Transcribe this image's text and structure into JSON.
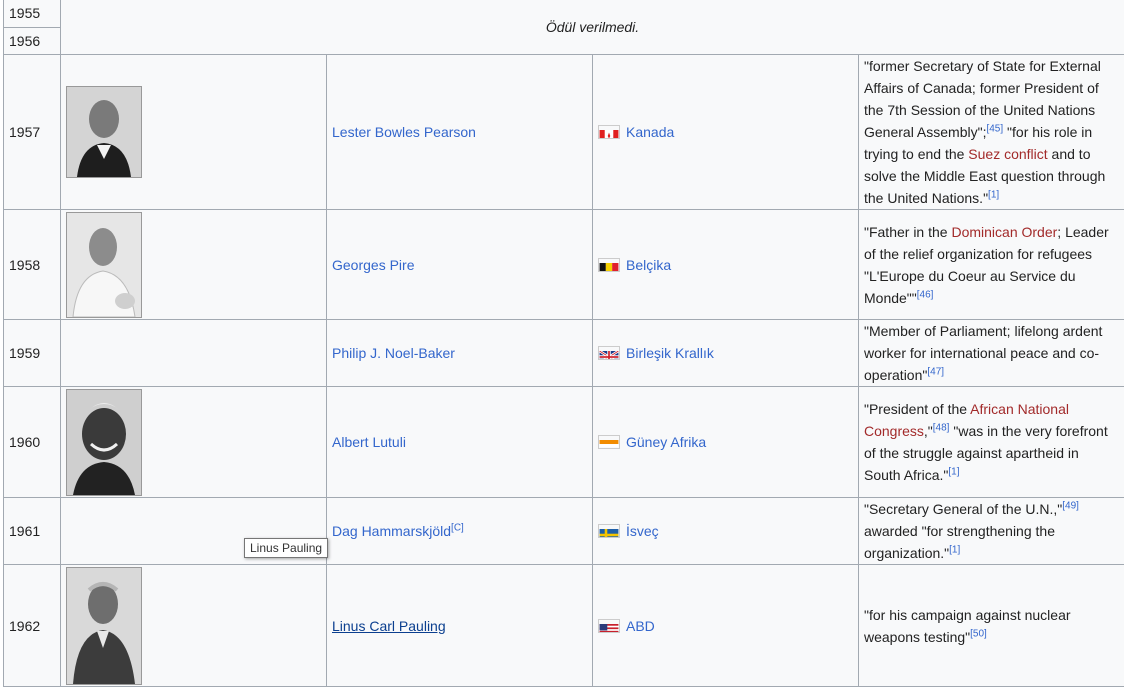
{
  "no_award_text": "Ödül verilmedi.",
  "rows": [
    {
      "year": "1955"
    },
    {
      "year": "1956"
    },
    {
      "year": "1957",
      "name": "Lester Bowles Pearson",
      "country": "Kanada",
      "flag": "canada-flag",
      "reason_parts": [
        "\"former Secretary of State for External Affairs of Canada; former President of the 7th Session of the United Nations General Assembly\";",
        "[45]",
        " \"for his role in trying to end the ",
        "Suez conflict",
        " and to solve the Middle East question through the United Nations.\"",
        "[1]"
      ]
    },
    {
      "year": "1958",
      "name": "Georges Pire",
      "country": "Belçika",
      "flag": "belgium-flag",
      "reason_parts": [
        "\"Father in the ",
        "Dominican Order",
        "; Leader of the relief organization for refugees \"L'Europe du Coeur au Service du Monde\"\"",
        "[46]"
      ]
    },
    {
      "year": "1959",
      "name": "Philip J. Noel-Baker",
      "country": "Birleşik Krallık",
      "flag": "uk-flag",
      "reason_parts": [
        "\"Member of Parliament; lifelong ardent worker for international peace and co-operation\"",
        "[47]"
      ]
    },
    {
      "year": "1960",
      "name": "Albert Lutuli",
      "country": "Güney Afrika",
      "flag": "south-africa-flag",
      "reason_parts": [
        "\"President of the ",
        "African National Congress",
        ",\"",
        "[48]",
        " \"was in the very forefront of the struggle against apartheid in South Africa.\"",
        "[1]"
      ]
    },
    {
      "year": "1961",
      "name": "Dag Hammarskjöld",
      "name_note": "[C]",
      "country": "İsveç",
      "flag": "sweden-flag",
      "reason_parts": [
        "\"Secretary General of the U.N.,\"",
        "[49]",
        " awarded \"for strengthening the organization.\"",
        "[1]"
      ]
    },
    {
      "year": "1962",
      "name": "Linus Carl Pauling",
      "country": "ABD",
      "flag": "usa-flag",
      "reason_parts": [
        "\"for his campaign against nuclear weapons testing\"",
        "[50]"
      ]
    }
  ],
  "tooltip": "Linus Pauling"
}
